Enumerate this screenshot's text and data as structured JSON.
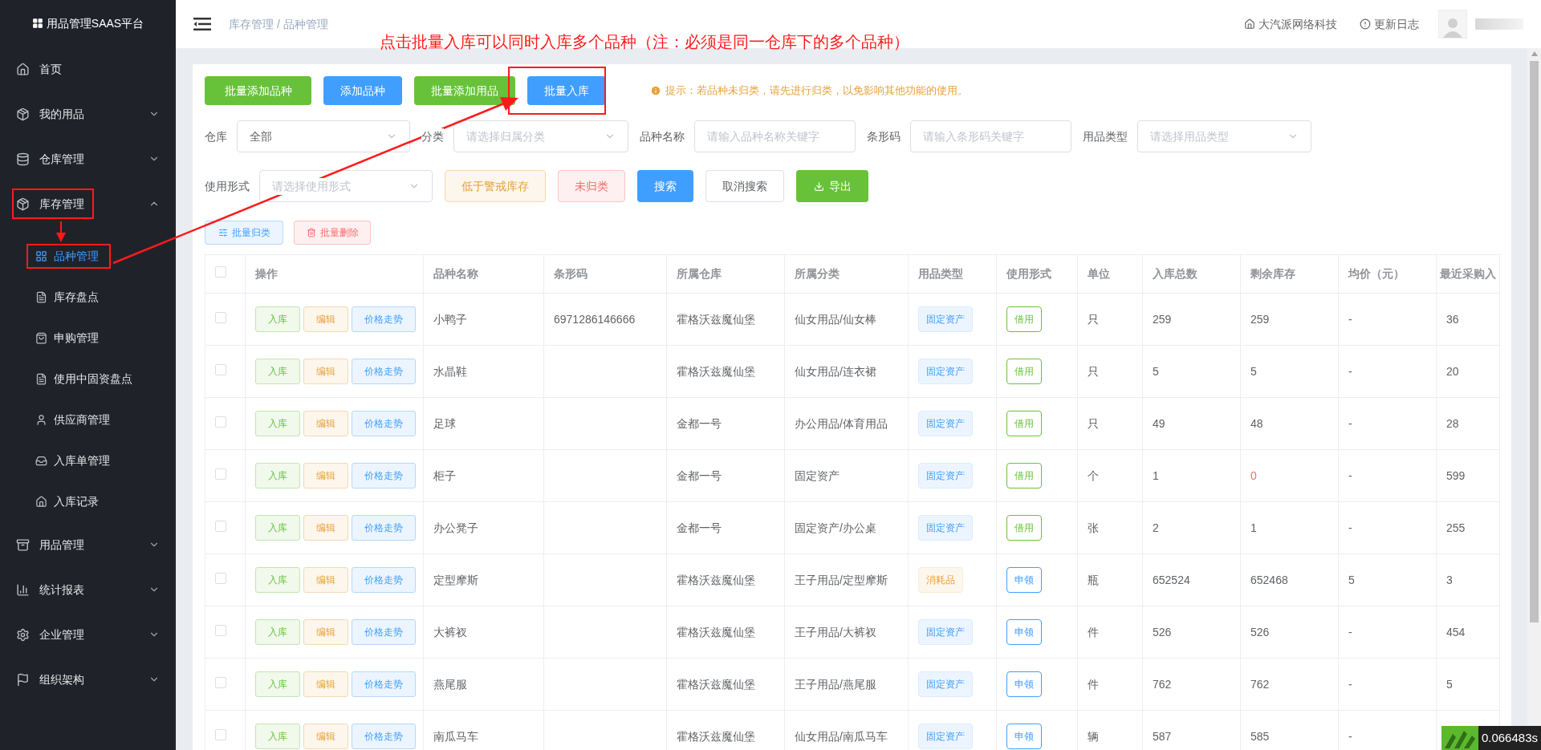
{
  "sidebar": {
    "logo": "用品管理SAAS平台",
    "items": [
      {
        "label": "首页",
        "selected": false
      },
      {
        "label": "我的用品",
        "expanded": false,
        "selected": false
      },
      {
        "label": "仓库管理",
        "expanded": false,
        "selected": false
      },
      {
        "label": "库存管理",
        "expanded": true,
        "selected": false,
        "children": [
          {
            "label": "品种管理",
            "selected": true
          },
          {
            "label": "库存盘点",
            "selected": false
          },
          {
            "label": "申购管理",
            "selected": false
          },
          {
            "label": "使用中固资盘点",
            "selected": false
          },
          {
            "label": "供应商管理",
            "selected": false
          },
          {
            "label": "入库单管理",
            "selected": false
          },
          {
            "label": "入库记录",
            "selected": false
          }
        ]
      },
      {
        "label": "用品管理",
        "expanded": false,
        "selected": false
      },
      {
        "label": "统计报表",
        "expanded": false,
        "selected": false
      },
      {
        "label": "企业管理",
        "expanded": false,
        "selected": false
      },
      {
        "label": "组织架构",
        "expanded": false,
        "selected": false
      }
    ]
  },
  "header": {
    "breadcrumb": "库存管理 / 品种管理",
    "links": [
      "大汽派网络科技",
      "更新日志"
    ]
  },
  "annotation": {
    "note": "点击批量入库可以同时入库多个品种（注：必须是同一仓库下的多个品种）"
  },
  "toolbar": {
    "buttons": [
      "批量添加品种",
      "添加品种",
      "批量添加用品",
      "批量入库"
    ],
    "tip": "提示：若品种未归类，请先进行归类，以免影响其他功能的使用。"
  },
  "filters": [
    {
      "label": "仓库",
      "kind": "select",
      "value": "全部"
    },
    {
      "label": "分类",
      "kind": "select",
      "placeholder": "请选择归属分类"
    },
    {
      "label": "品种名称",
      "kind": "text",
      "placeholder": "请输入品种名称关键字"
    },
    {
      "label": "条形码",
      "kind": "text",
      "placeholder": "请输入条形码关键字"
    },
    {
      "label": "用品类型",
      "kind": "select",
      "placeholder": "请选择用品类型"
    },
    {
      "label": "使用形式",
      "kind": "select",
      "placeholder": "请选择使用形式"
    }
  ],
  "filter_buttons": [
    "低于警戒库存",
    "未归类",
    "搜索",
    "取消搜索",
    "导出"
  ],
  "batch_buttons": [
    "批量归类",
    "批量删除"
  ],
  "table": {
    "select_all": false,
    "columns": [
      "操作",
      "品种名称",
      "条形码",
      "所属仓库",
      "所属分类",
      "用品类型",
      "使用形式",
      "单位",
      "入库总数",
      "剩余库存",
      "均价（元）",
      "最近采购入"
    ],
    "rows": [
      {
        "checked": false,
        "actions": [
          "入库",
          "编辑",
          "价格走势"
        ],
        "name": "小鸭子",
        "barcode": "6971286146666",
        "warehouse": "霍格沃兹魔仙堡",
        "category": "仙女用品/仙女棒",
        "type": {
          "label": "固定资产",
          "kind": "fixed"
        },
        "usage": {
          "label": "借用",
          "kind": "borrow"
        },
        "unit": "只",
        "total": "259",
        "remaining": "259",
        "low": false,
        "avg": "-",
        "recent": "36"
      },
      {
        "checked": false,
        "actions": [
          "入库",
          "编辑",
          "价格走势"
        ],
        "name": "水晶鞋",
        "warehouse": "霍格沃兹魔仙堡",
        "category": "仙女用品/连衣裙",
        "type": {
          "label": "固定资产",
          "kind": "fixed"
        },
        "usage": {
          "label": "借用",
          "kind": "borrow"
        },
        "unit": "只",
        "total": "5",
        "remaining": "5",
        "low": false,
        "avg": "-",
        "recent": "20"
      },
      {
        "checked": false,
        "actions": [
          "入库",
          "编辑",
          "价格走势"
        ],
        "name": "足球",
        "warehouse": "金都一号",
        "category": "办公用品/体育用品",
        "type": {
          "label": "固定资产",
          "kind": "fixed"
        },
        "usage": {
          "label": "借用",
          "kind": "borrow"
        },
        "unit": "只",
        "total": "49",
        "remaining": "48",
        "low": false,
        "avg": "-",
        "recent": "28"
      },
      {
        "checked": false,
        "actions": [
          "入库",
          "编辑",
          "价格走势"
        ],
        "name": "柜子",
        "warehouse": "金都一号",
        "category": "固定资产",
        "type": {
          "label": "固定资产",
          "kind": "fixed"
        },
        "usage": {
          "label": "借用",
          "kind": "borrow"
        },
        "unit": "个",
        "total": "1",
        "remaining": "0",
        "low": true,
        "avg": "-",
        "recent": "599"
      },
      {
        "checked": false,
        "actions": [
          "入库",
          "编辑",
          "价格走势"
        ],
        "name": "办公凳子",
        "warehouse": "金都一号",
        "category": "固定资产/办公桌",
        "type": {
          "label": "固定资产",
          "kind": "fixed"
        },
        "usage": {
          "label": "借用",
          "kind": "borrow"
        },
        "unit": "张",
        "total": "2",
        "remaining": "1",
        "low": false,
        "avg": "-",
        "recent": "255"
      },
      {
        "checked": false,
        "actions": [
          "入库",
          "编辑",
          "价格走势"
        ],
        "name": "定型摩斯",
        "warehouse": "霍格沃兹魔仙堡",
        "category": "王子用品/定型摩斯",
        "type": {
          "label": "消耗品",
          "kind": "consumable"
        },
        "usage": {
          "label": "申领",
          "kind": "apply"
        },
        "unit": "瓶",
        "total": "652524",
        "remaining": "652468",
        "low": false,
        "avg": "5",
        "recent": "3"
      },
      {
        "checked": false,
        "actions": [
          "入库",
          "编辑",
          "价格走势"
        ],
        "name": "大裤衩",
        "warehouse": "霍格沃兹魔仙堡",
        "category": "王子用品/大裤衩",
        "type": {
          "label": "固定资产",
          "kind": "fixed"
        },
        "usage": {
          "label": "申领",
          "kind": "apply"
        },
        "unit": "件",
        "total": "526",
        "remaining": "526",
        "low": false,
        "avg": "-",
        "recent": "454"
      },
      {
        "checked": false,
        "actions": [
          "入库",
          "编辑",
          "价格走势"
        ],
        "name": "燕尾服",
        "warehouse": "霍格沃兹魔仙堡",
        "category": "王子用品/燕尾服",
        "type": {
          "label": "固定资产",
          "kind": "fixed"
        },
        "usage": {
          "label": "申领",
          "kind": "apply"
        },
        "unit": "件",
        "total": "762",
        "remaining": "762",
        "low": false,
        "avg": "-",
        "recent": "5"
      },
      {
        "checked": false,
        "actions": [
          "入库",
          "编辑",
          "价格走势"
        ],
        "name": "南瓜马车",
        "warehouse": "霍格沃兹魔仙堡",
        "category": "仙女用品/南瓜马车",
        "type": {
          "label": "固定资产",
          "kind": "fixed"
        },
        "usage": {
          "label": "申领",
          "kind": "apply"
        },
        "unit": "辆",
        "total": "587",
        "remaining": "585",
        "low": false,
        "avg": "-"
      }
    ]
  },
  "timer": "0.066483s"
}
